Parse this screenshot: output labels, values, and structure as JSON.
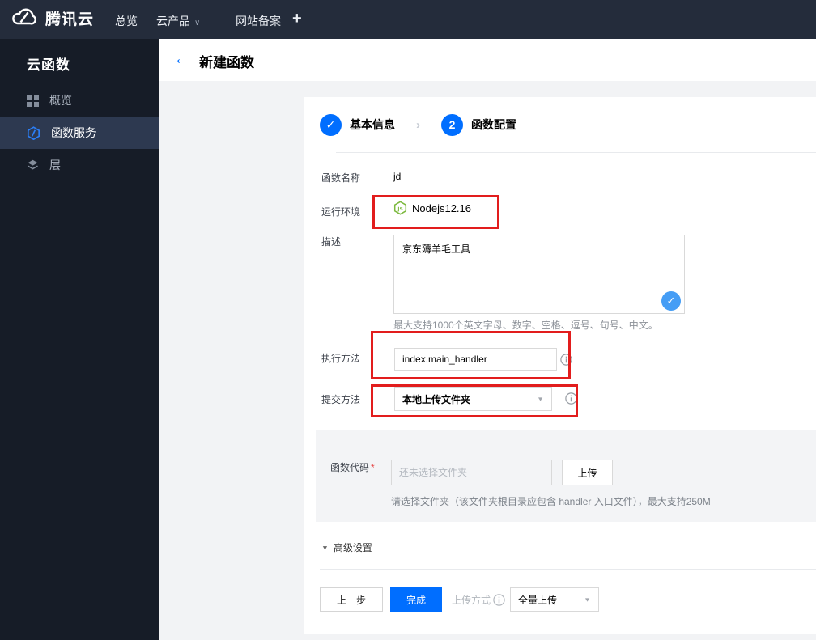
{
  "topbar": {
    "brand": "腾讯云",
    "nav_overview": "总览",
    "nav_products": "云产品",
    "nav_products_caret": "∨",
    "nav_beian": "网站备案",
    "nav_plus": "+"
  },
  "sidebar": {
    "title": "云函数",
    "items": [
      {
        "label": "概览",
        "icon": "grid-icon",
        "active": false
      },
      {
        "label": "函数服务",
        "icon": "function-icon",
        "active": true
      },
      {
        "label": "层",
        "icon": "layers-icon",
        "active": false
      }
    ]
  },
  "header": {
    "back_icon": "←",
    "title": "新建函数"
  },
  "steps": {
    "step1_mark": "✓",
    "step1_label": "基本信息",
    "chevron": "›",
    "step2_num": "2",
    "step2_label": "函数配置"
  },
  "form": {
    "name": {
      "label": "函数名称",
      "value": "jd"
    },
    "runtime": {
      "label": "运行环境",
      "value": "Nodejs12.16",
      "icon": "nodejs-icon"
    },
    "description": {
      "label": "描述",
      "value": "京东薅羊毛工具",
      "check_mark": "✓",
      "hint": "最大支持1000个英文字母、数字、空格、逗号、句号、中文。"
    },
    "handler": {
      "label": "执行方法",
      "value": "index.main_handler"
    },
    "submit_method": {
      "label": "提交方法",
      "value": "本地上传文件夹",
      "caret": "▼"
    },
    "code": {
      "label": "函数代码",
      "required_mark": "*",
      "placeholder": "还未选择文件夹",
      "upload_label": "上传",
      "hint": "请选择文件夹（该文件夹根目录应包含 handler 入口文件），最大支持250M"
    },
    "advanced": {
      "caret": "▼",
      "label": "高级设置"
    }
  },
  "footer": {
    "prev_label": "上一步",
    "finish_label": "完成",
    "upload_mode_label": "上传方式",
    "upload_mode_value": "全量上传",
    "caret": "▼"
  },
  "colors": {
    "accent_blue": "#006eff",
    "check_blue": "#459df5",
    "annotation_red": "#e21d1d",
    "node_green": "#7cb93e",
    "topbar_bg": "#242c3b",
    "sidebar_bg": "#161c27",
    "sidebar_active_bg": "#2d3950"
  }
}
